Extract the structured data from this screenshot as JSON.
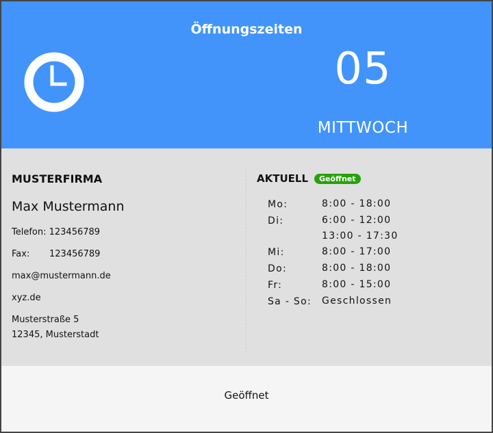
{
  "header": {
    "title": "Öffnungszeiten",
    "day_number": "05",
    "day_name": "MITTWOCH",
    "icon": "clock-icon",
    "background_color": "#4294fb"
  },
  "company": {
    "name": "MUSTERFIRMA",
    "person": "Max Mustermann",
    "phone": "Telefon: 123456789",
    "fax_label": "Fax:",
    "fax_value": "123456789",
    "email": "max@mustermann.de",
    "website": "xyz.de",
    "street": "Musterstraße 5",
    "city": "12345, Musterstadt"
  },
  "current": {
    "label": "AKTUELL",
    "status": "Geöffnet",
    "status_color": "#27a10a"
  },
  "hours": [
    {
      "day": "Mo:",
      "times": [
        "8:00 - 18:00"
      ]
    },
    {
      "day": "Di:",
      "times": [
        "6:00 - 12:00",
        "13:00 - 17:30"
      ]
    },
    {
      "day": "Mi:",
      "times": [
        "8:00 - 17:00"
      ]
    },
    {
      "day": "Do:",
      "times": [
        "8:00 - 18:00"
      ]
    },
    {
      "day": "Fr:",
      "times": [
        "8:00 - 15:00"
      ]
    },
    {
      "day": "Sa - So:",
      "times": [
        "Geschlossen"
      ]
    }
  ],
  "footer": {
    "status": "Geöffnet"
  }
}
